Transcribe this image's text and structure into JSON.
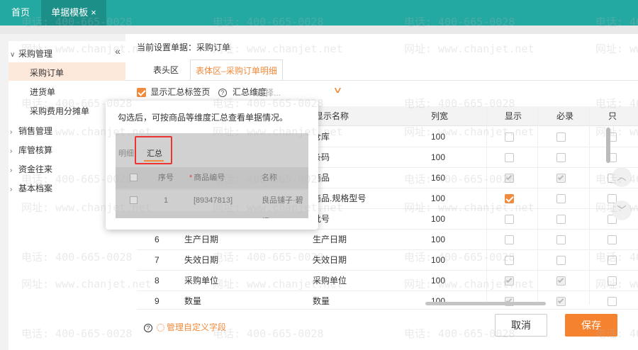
{
  "top_tabs": {
    "home": "首页",
    "active": "单据模板",
    "close": "×"
  },
  "sidebar": {
    "collapse": "«",
    "groups": [
      {
        "label": "采购管理",
        "caret": "∨"
      },
      {
        "label": "销售管理",
        "caret": "›"
      },
      {
        "label": "库管核算",
        "caret": "›"
      },
      {
        "label": "资金往来",
        "caret": "›"
      },
      {
        "label": "基本档案",
        "caret": "›"
      }
    ],
    "sub_items": [
      "采购订单",
      "进货单",
      "采购费用分摊单"
    ]
  },
  "main": {
    "current_setting": "当前设置单据：采购订单",
    "tabs": [
      "表头区",
      "表体区–采购订单明细"
    ],
    "show_summary_label": "显示汇总标签页",
    "help_glyph": "?",
    "summary_dimension_label": "汇总维度",
    "select_placeholder": "选择...",
    "select_caret": "∨"
  },
  "table": {
    "columns": [
      "显示名称",
      "列宽",
      "显示",
      "必录",
      "只"
    ],
    "rows": [
      {
        "no": "",
        "name": "",
        "display": "仓库",
        "width": "100",
        "show": false,
        "show_disabled": false,
        "req": false,
        "req_disabled": false
      },
      {
        "no": "",
        "name": "",
        "display": "条码",
        "width": "100",
        "show": false,
        "show_disabled": false,
        "req": false,
        "req_disabled": false
      },
      {
        "no": "",
        "name": "",
        "display": "商品",
        "width": "160",
        "show": true,
        "show_disabled": true,
        "req": true,
        "req_disabled": true
      },
      {
        "no": "",
        "name": "",
        "display": "商品.规格型号",
        "width": "100",
        "show": true,
        "show_disabled": false,
        "req": false,
        "req_disabled": false
      },
      {
        "no": "",
        "name": "",
        "display": "批号",
        "width": "100",
        "show": false,
        "show_disabled": false,
        "req": false,
        "req_disabled": false
      },
      {
        "no": "6",
        "name": "生产日期",
        "display": "生产日期",
        "width": "100",
        "show": false,
        "show_disabled": false,
        "req": false,
        "req_disabled": false
      },
      {
        "no": "7",
        "name": "失效日期",
        "display": "失效日期",
        "width": "100",
        "show": false,
        "show_disabled": false,
        "req": false,
        "req_disabled": false
      },
      {
        "no": "8",
        "name": "采购单位",
        "display": "采购单位",
        "width": "100",
        "show": true,
        "show_disabled": true,
        "req": true,
        "req_disabled": true
      },
      {
        "no": "9",
        "name": "数量",
        "display": "数量",
        "width": "100",
        "show": true,
        "show_disabled": true,
        "req": true,
        "req_disabled": true
      }
    ]
  },
  "popover": {
    "hint": "勾选后，可按商品等维度汇总查看单据情况。",
    "preview_tabs": [
      "明细",
      "汇总"
    ],
    "preview_headers": [
      "序号",
      "商品编号",
      "名称"
    ],
    "preview_row": [
      "1",
      "[89347813]",
      "良品铺子·碧根"
    ]
  },
  "nav_buttons": {
    "up": "︿",
    "down": "﹀"
  },
  "footer": {
    "help_glyph": "?",
    "manage_fields": "管理自定义字段",
    "cancel": "取消",
    "save": "保存"
  },
  "watermark": {
    "phone": "电话: 400-665-0028",
    "site": "网址: www.chanjet.net"
  },
  "colors": {
    "teal": "#23a9a2",
    "orange": "#f5822e"
  }
}
